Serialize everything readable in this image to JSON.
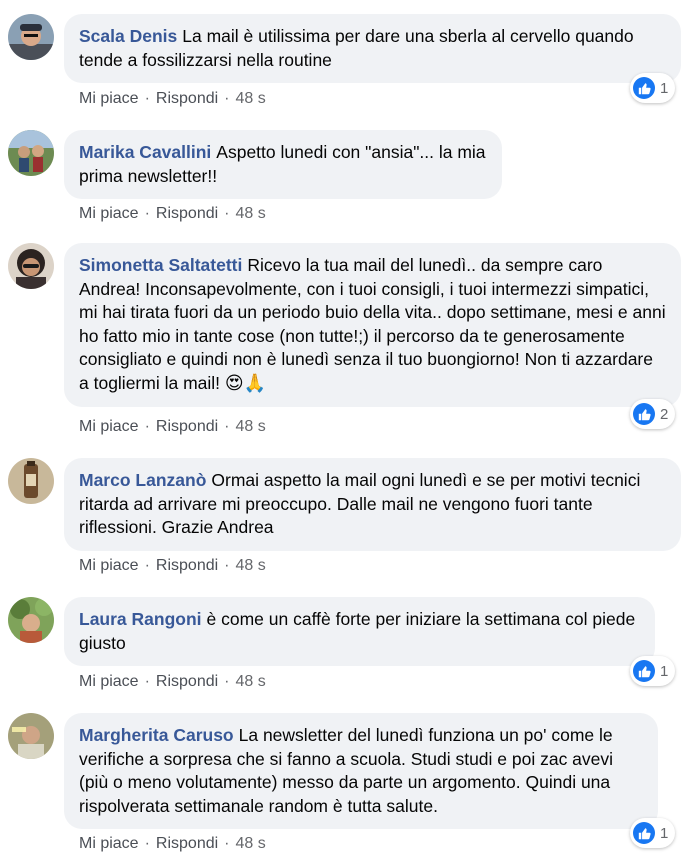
{
  "actions": {
    "like": "Mi piace",
    "reply": "Rispondi",
    "separator": "·"
  },
  "colors": {
    "author": "#385898",
    "bubble": "#f0f2f5",
    "like_blue": "#1877f2",
    "meta": "#65676b"
  },
  "comments": [
    {
      "author": "Scala Denis",
      "text": "La mail è utilissima per dare una sberla al cervello quando tende a fossilizzarsi nella routine",
      "time": "48 s",
      "reactions": {
        "icon": "like-icon",
        "count": "1"
      }
    },
    {
      "author": "Marika Cavallini",
      "text": "Aspetto lunedi con \"ansia\"... la mia prima newsletter!!",
      "time": "48 s"
    },
    {
      "author": "Simonetta Saltatetti",
      "text": "Ricevo la tua mail del lunedì.. da sempre caro Andrea! Inconsapevolmente, con i tuoi consigli, i tuoi intermezzi simpatici, mi hai tirata fuori da un periodo buio della vita.. dopo settimane, mesi e anni ho fatto mio in tante cose (non tutte!;) il percorso da te generosamente consigliato e quindi non è lunedì senza il tuo buongiorno! Non ti azzardare a togliermi la mail!",
      "emoji": "😍🙏",
      "time": "48 s",
      "reactions": {
        "icon": "like-icon",
        "count": "2"
      }
    },
    {
      "author": "Marco Lanzanò",
      "text": "Ormai aspetto la mail ogni lunedì e se per motivi tecnici ritarda ad arrivare mi preoccupo. Dalle mail ne vengono fuori tante riflessioni. Grazie Andrea",
      "time": "48 s"
    },
    {
      "author": "Laura Rangoni",
      "text": "è come un caffè forte per iniziare la settimana col piede giusto",
      "time": "48 s",
      "reactions": {
        "icon": "like-icon",
        "count": "1"
      }
    },
    {
      "author": "Margherita Caruso",
      "text": "La newsletter del lunedì funziona un po' come le verifiche a sorpresa che si fanno a scuola. Studi studi e poi zac avevi (più o meno volutamente) messo da parte un argomento. Quindi una rispolverata settimanale random è tutta salute.",
      "time": "48 s",
      "reactions": {
        "icon": "like-icon",
        "count": "1"
      }
    }
  ]
}
